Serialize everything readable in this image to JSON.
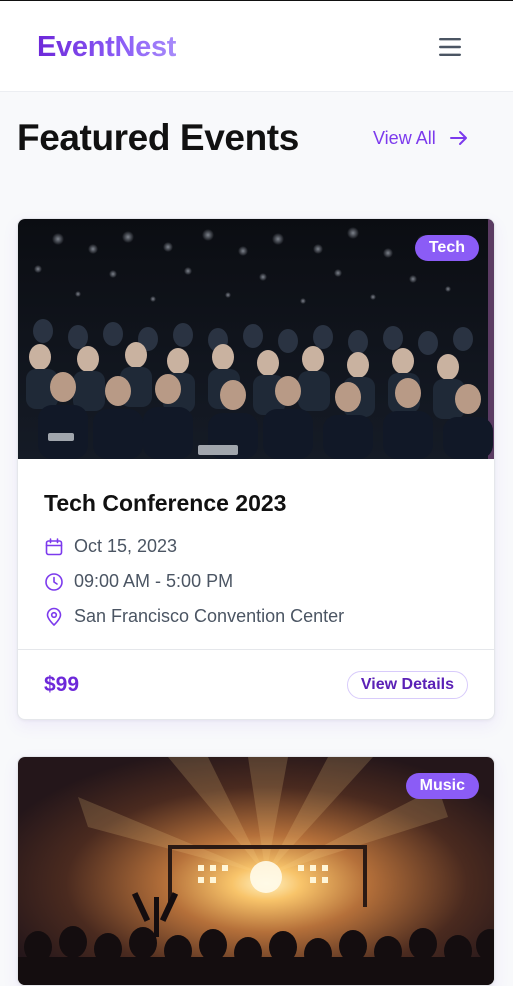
{
  "header": {
    "logo": "EventNest",
    "menu_icon": "hamburger-menu-icon"
  },
  "section": {
    "title": "Featured Events",
    "view_all_label": "View All",
    "view_all_icon": "arrow-right-icon"
  },
  "colors": {
    "accent": "#7c3aed",
    "badge": "#8b5cf6",
    "price": "#6d28d9"
  },
  "events": [
    {
      "category": "Tech",
      "image": "conference-audience-photo",
      "title": "Tech Conference 2023",
      "date": "Oct 15, 2023",
      "time": "09:00 AM - 5:00 PM",
      "location": "San Francisco Convention Center",
      "price": "$99",
      "details_label": "View Details",
      "icons": [
        "calendar-icon",
        "clock-icon",
        "map-pin-icon"
      ]
    },
    {
      "category": "Music",
      "image": "concert-stage-photo"
    }
  ]
}
